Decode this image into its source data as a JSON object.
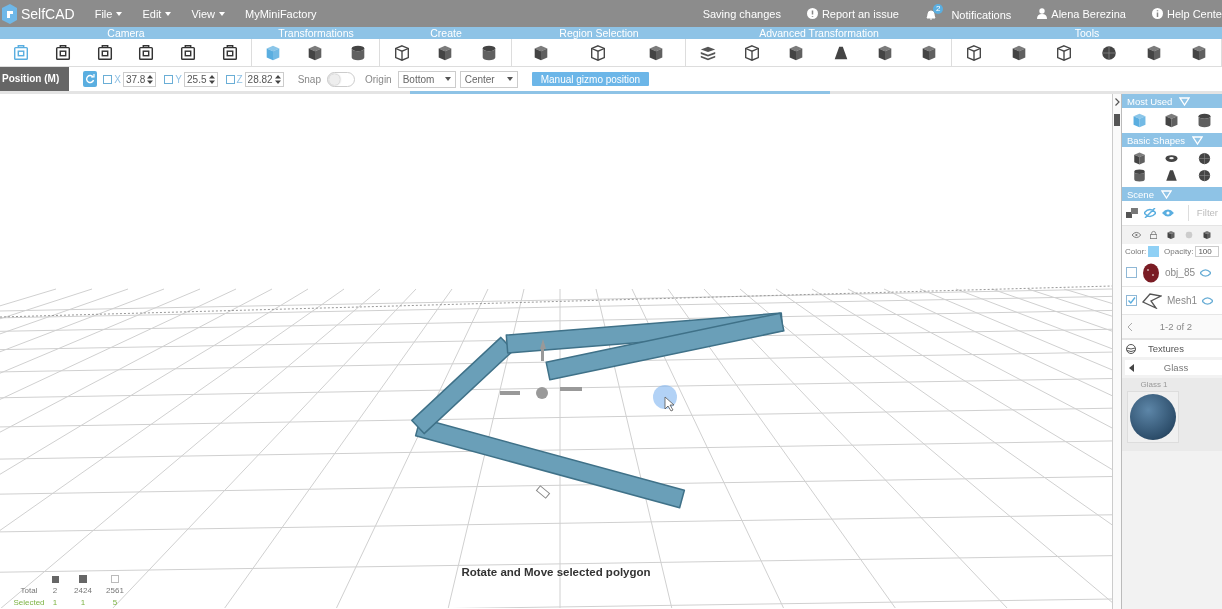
{
  "app": {
    "name": "SelfCAD"
  },
  "menu": [
    {
      "label": "File",
      "dropdown": true
    },
    {
      "label": "Edit",
      "dropdown": true
    },
    {
      "label": "View",
      "dropdown": true
    },
    {
      "label": "MyMiniFactory",
      "dropdown": false
    }
  ],
  "header_right": {
    "status": "Saving changes",
    "report": "Report an issue",
    "notifications": {
      "label": "Notifications",
      "badge": "2"
    },
    "user": "Alena Berezina",
    "help": "Help Cente"
  },
  "toolbar_groups": [
    {
      "label": "Camera"
    },
    {
      "label": "Transformations"
    },
    {
      "label": "Create"
    },
    {
      "label": "Region Selection"
    },
    {
      "label": "Advanced Transformation"
    },
    {
      "label": "Tools"
    }
  ],
  "options": {
    "mode": "Position (M)",
    "axes": [
      {
        "label": "X",
        "checked": false,
        "value": "37.8"
      },
      {
        "label": "Y",
        "checked": false,
        "value": "25.5"
      },
      {
        "label": "Z",
        "checked": false,
        "value": "28.82"
      }
    ],
    "snap": {
      "label": "Snap",
      "on": false
    },
    "origin": {
      "label": "Origin",
      "selects": [
        "Bottom",
        "Center"
      ]
    },
    "button": "Manual gizmo position"
  },
  "sidebar": {
    "most_used": {
      "title": "Most Used"
    },
    "basic_shapes": {
      "title": "Basic Shapes"
    },
    "scene": {
      "title": "Scene",
      "filter_placeholder": "Filter",
      "color_label": "Color:",
      "opacity_label": "Opacity:",
      "opacity": "100",
      "items": [
        {
          "name": "obj_85",
          "checked": false
        },
        {
          "name": "Mesh1",
          "checked": true
        }
      ],
      "pager": "1-2 of 2"
    },
    "textures": {
      "title": "Textures",
      "category": "Glass",
      "items": [
        {
          "name": "Glass 1"
        }
      ]
    }
  },
  "stats": {
    "rows": [
      {
        "label": "Total",
        "kind": "total",
        "values": [
          "2",
          "2424",
          "2561"
        ]
      },
      {
        "label": "Selected",
        "kind": "selected",
        "values": [
          "1",
          "1",
          "5"
        ]
      }
    ]
  },
  "status_message": "Rotate and Move selected polygon"
}
